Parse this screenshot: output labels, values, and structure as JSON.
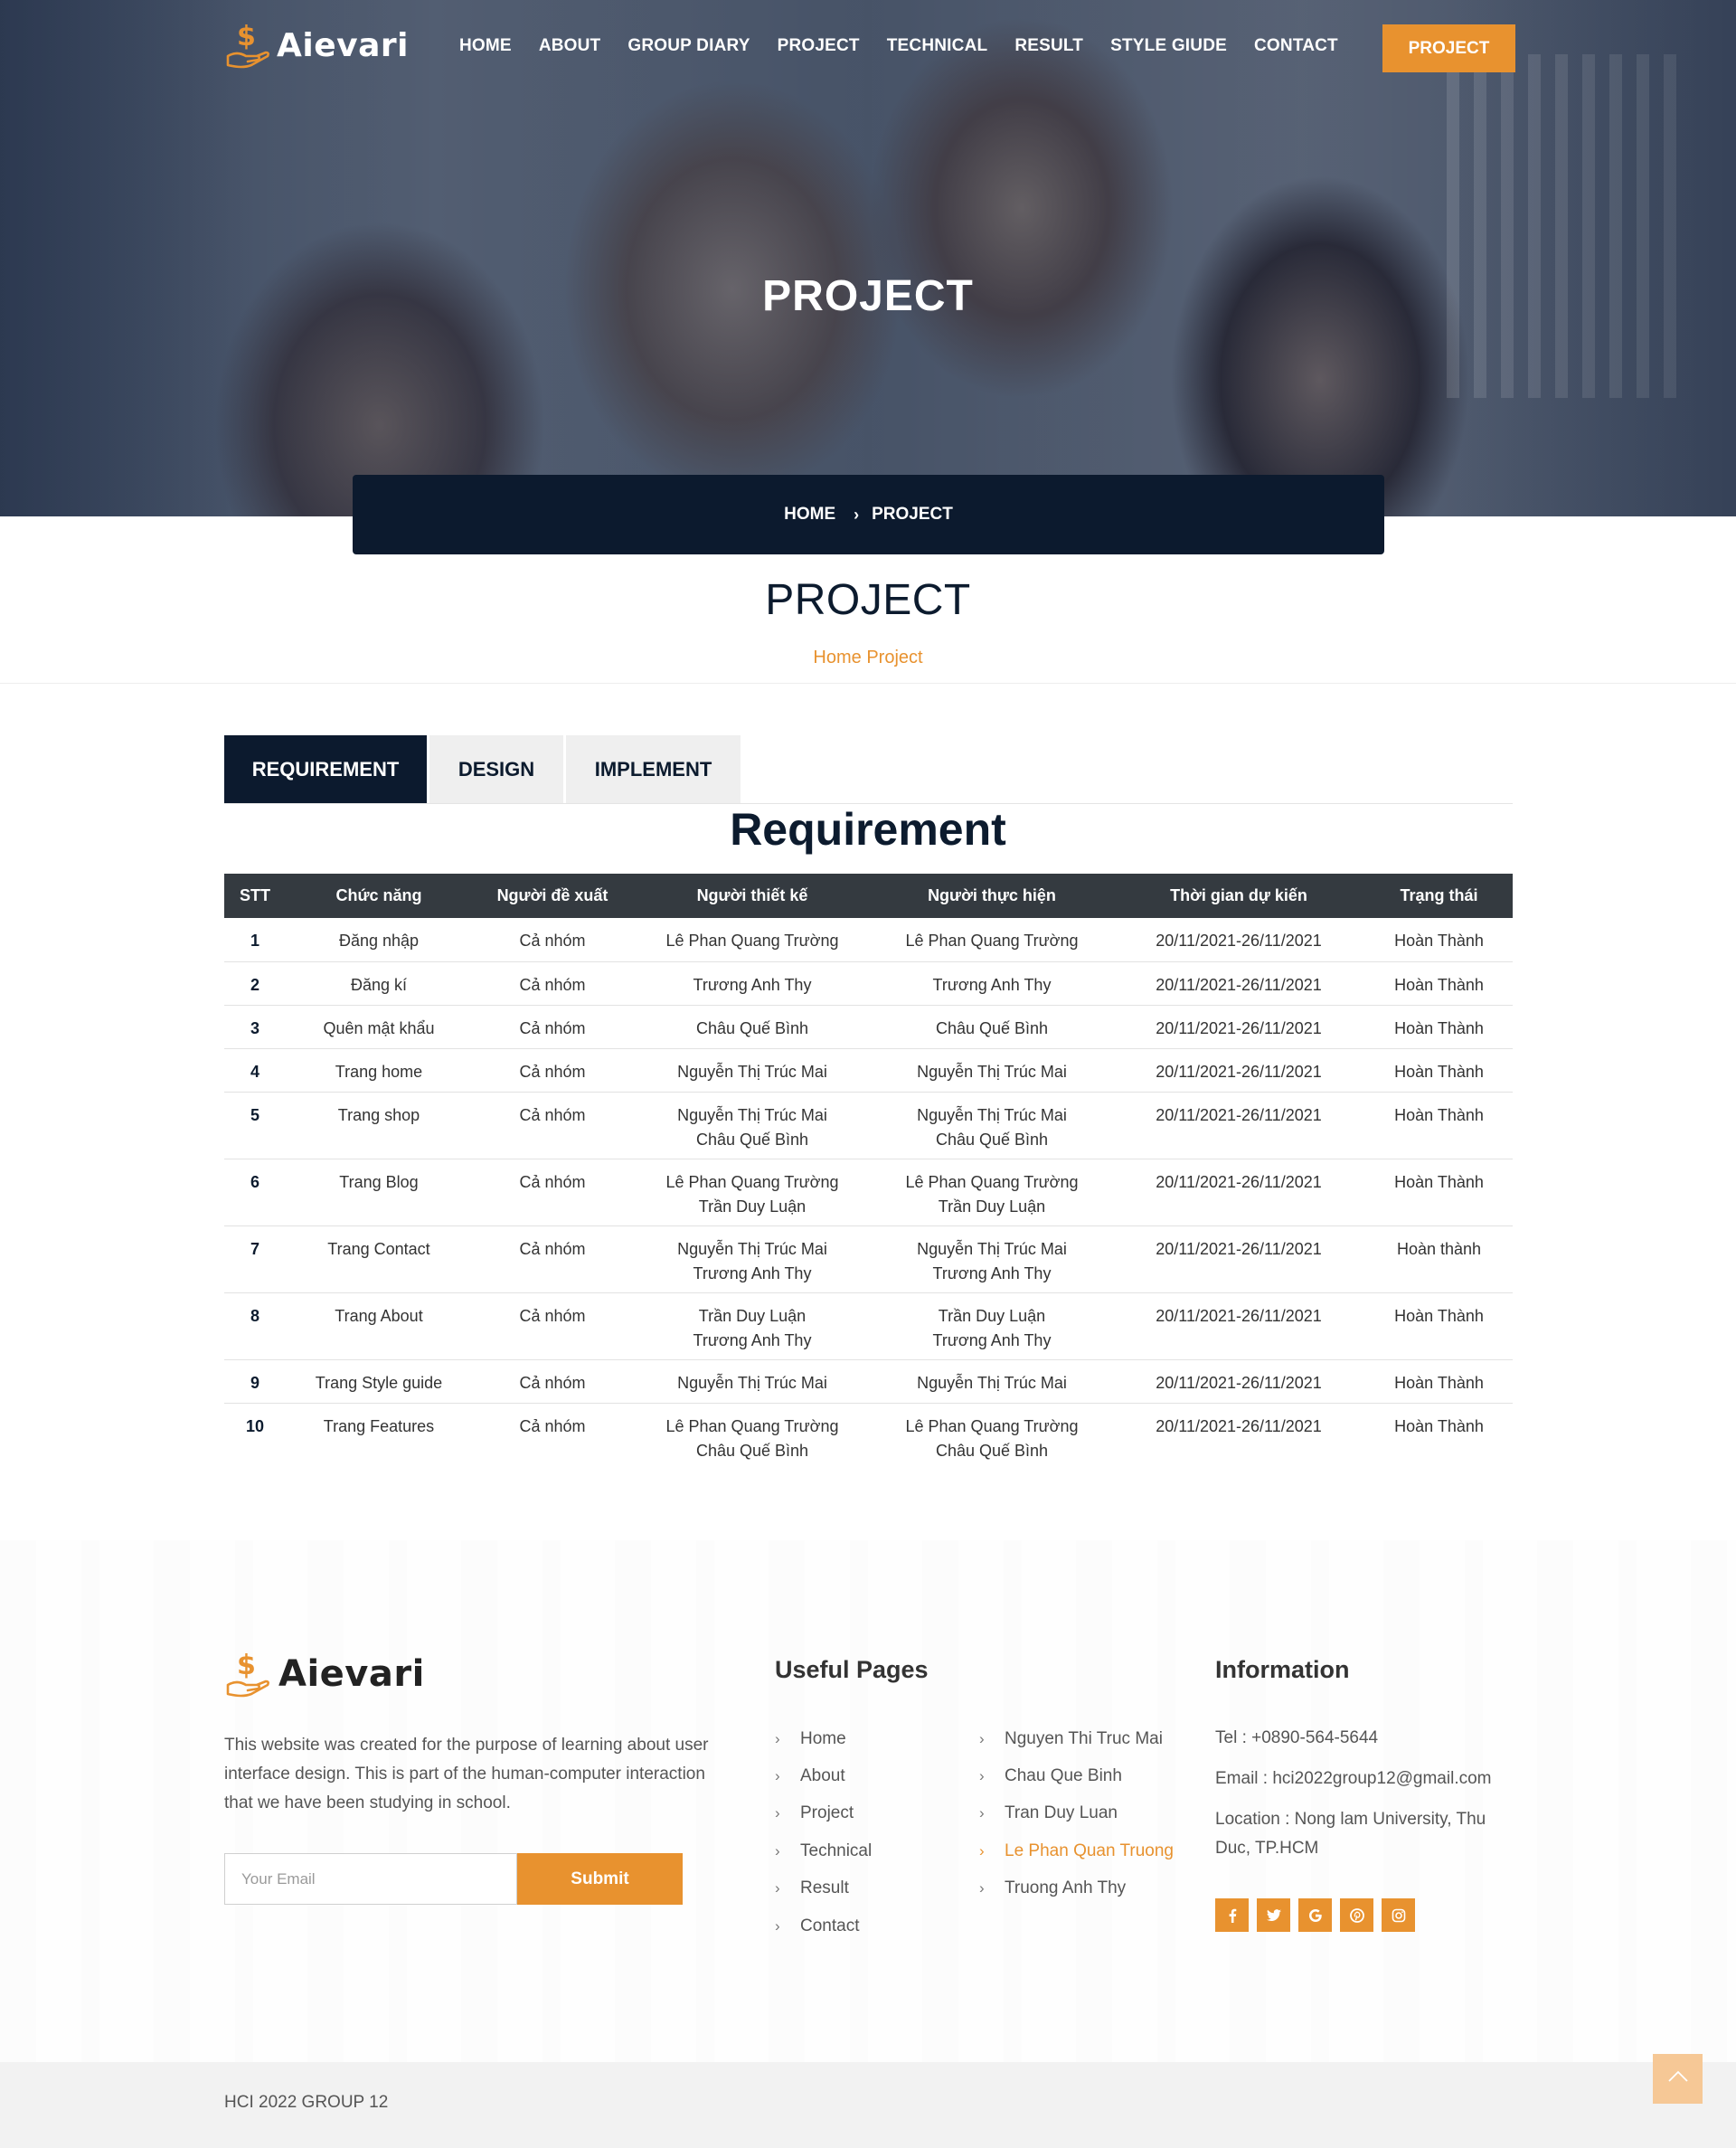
{
  "header": {
    "logo_text": "Aievari",
    "nav": [
      "HOME",
      "ABOUT",
      "GROUP DIARY",
      "PROJECT",
      "TECHNICAL",
      "RESULT",
      "STYLE GIUDE",
      "CONTACT"
    ],
    "cta_label": "PROJECT"
  },
  "hero": {
    "title": "PROJECT",
    "breadcrumb_home": "HOME",
    "breadcrumb_separator": "›",
    "breadcrumb_current": "PROJECT"
  },
  "page": {
    "title": "PROJECT",
    "subtitle": "Home Project"
  },
  "tabs": [
    "REQUIREMENT",
    "DESIGN",
    "IMPLEMENT"
  ],
  "active_tab": 0,
  "section_heading": "Requirement",
  "table": {
    "columns": [
      "STT",
      "Chức năng",
      "Người đề xuất",
      "Người thiết kế",
      "Người thực hiện",
      "Thời gian dự kiến",
      "Trạng thái"
    ],
    "rows": [
      [
        "1",
        "Đăng nhập",
        "Cả nhóm",
        "Lê Phan Quang Trường",
        "Lê Phan Quang Trường",
        "20/11/2021-26/11/2021",
        "Hoàn Thành"
      ],
      [
        "2",
        "Đăng kí",
        "Cả nhóm",
        "Trương Anh Thy",
        "Trương Anh Thy",
        "20/11/2021-26/11/2021",
        "Hoàn Thành"
      ],
      [
        "3",
        "Quên mật khẩu",
        "Cả nhóm",
        "Châu Quế Bình",
        "Châu Quế Bình",
        "20/11/2021-26/11/2021",
        "Hoàn Thành"
      ],
      [
        "4",
        "Trang home",
        "Cả nhóm",
        "Nguyễn Thị Trúc Mai",
        "Nguyễn Thị Trúc Mai",
        "20/11/2021-26/11/2021",
        "Hoàn Thành"
      ],
      [
        "5",
        "Trang shop",
        "Cả nhóm",
        "Nguyễn Thị Trúc Mai\nChâu Quế Bình",
        "Nguyễn Thị Trúc Mai\nChâu Quế Bình",
        "20/11/2021-26/11/2021",
        "Hoàn Thành"
      ],
      [
        "6",
        "Trang Blog",
        "Cả nhóm",
        "Lê Phan Quang Trường\nTrần Duy Luận",
        "Lê Phan Quang Trường\nTrần Duy Luận",
        "20/11/2021-26/11/2021",
        "Hoàn Thành"
      ],
      [
        "7",
        "Trang Contact",
        "Cả nhóm",
        "Nguyễn Thị Trúc Mai\nTrương Anh Thy",
        "Nguyễn Thị Trúc Mai\nTrương Anh Thy",
        "20/11/2021-26/11/2021",
        "Hoàn thành"
      ],
      [
        "8",
        "Trang About",
        "Cả nhóm",
        "Trần Duy Luận\nTrương Anh Thy",
        "Trần Duy Luận\nTrương Anh Thy",
        "20/11/2021-26/11/2021",
        "Hoàn Thành"
      ],
      [
        "9",
        "Trang Style guide",
        "Cả nhóm",
        "Nguyễn Thị Trúc Mai",
        "Nguyễn Thị Trúc Mai",
        "20/11/2021-26/11/2021",
        "Hoàn Thành"
      ],
      [
        "10",
        "Trang Features",
        "Cả nhóm",
        "Lê Phan Quang Trường\nChâu Quế Bình",
        "Lê Phan Quang Trường\nChâu Quế Bình",
        "20/11/2021-26/11/2021",
        "Hoàn Thành"
      ]
    ]
  },
  "footer": {
    "logo_text": "Aievari",
    "description": "This website was created for the purpose of learning about user interface design. This is part of the human-computer interaction that we have been studying in school.",
    "email_placeholder": "Your Email",
    "submit_label": "Submit",
    "useful_heading": "Useful Pages",
    "useful_links": [
      "Home",
      "About",
      "Project",
      "Technical",
      "Result",
      "Contact"
    ],
    "member_links": [
      "Nguyen Thi Truc Mai",
      "Chau Que Binh",
      "Tran Duy Luan",
      "Le Phan Quan Truong",
      "Truong Anh Thy"
    ],
    "highlighted_member": 3,
    "info_heading": "Information",
    "tel": "Tel : +0890-564-5644",
    "email": "Email : hci2022group12@gmail.com",
    "location": "Location : Nong lam University, Thu Duc, TP.HCM",
    "socials": [
      "facebook-icon",
      "twitter-icon",
      "google-icon",
      "pinterest-icon",
      "instagram-icon"
    ],
    "copyright": "HCI 2022 GROUP 12"
  },
  "colors": {
    "accent": "#e8922f",
    "navy": "#0c1a2e",
    "table_header": "#343a40"
  }
}
